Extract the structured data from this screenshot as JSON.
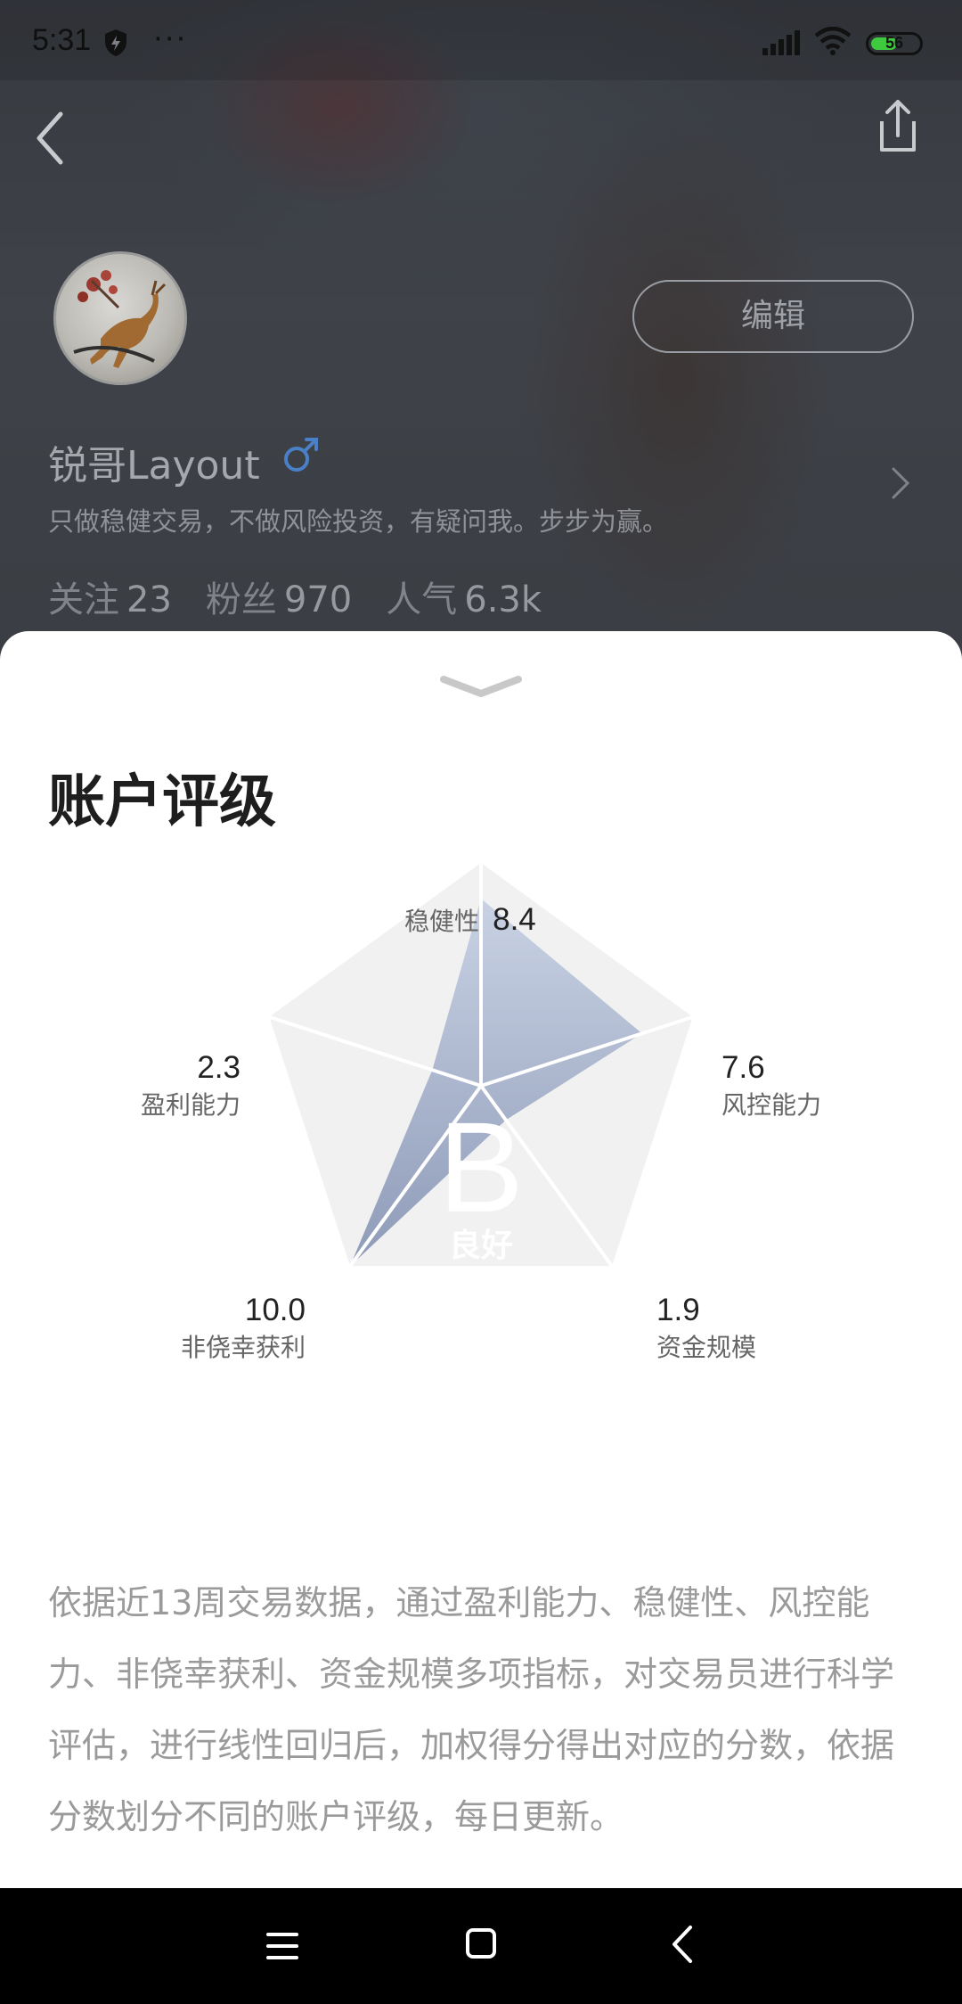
{
  "status_bar": {
    "time": "5:31",
    "dots": "···",
    "battery": "56",
    "battery_level": 0.56,
    "battery_color": "#3ec93e"
  },
  "header": {
    "back_icon": "chevron-left-icon",
    "share_icon": "share-icon"
  },
  "profile": {
    "username": "锐哥Layout",
    "gender_icon": "male-icon",
    "bio": "只做稳健交易，不做风险投资，有疑问我。步步为赢。",
    "edit_label": "编辑",
    "stats": [
      {
        "label": "关注",
        "value": "23"
      },
      {
        "label": "粉丝",
        "value": "970"
      },
      {
        "label": "人气",
        "value": "6.3k"
      }
    ]
  },
  "sheet": {
    "title": "账户评级",
    "grade_letter": "B",
    "grade_text": "良好",
    "description": "依据近13周交易数据，通过盈利能力、稳健性、风控能力、非侥幸获利、资金规模多项指标，对交易员进行科学评估，进行线性回归后，加权得分得出对应的分数，依据分数划分不同的账户评级，每日更新。"
  },
  "chart_data": {
    "type": "radar",
    "axes": [
      {
        "name": "稳健性",
        "value": 8.4
      },
      {
        "name": "风控能力",
        "value": 7.6
      },
      {
        "name": "资金规模",
        "value": 1.9
      },
      {
        "name": "非侥幸获利",
        "value": 10.0
      },
      {
        "name": "盈利能力",
        "value": 2.3
      }
    ],
    "value_labels": [
      "8.4",
      "7.6",
      "1.9",
      "10.0",
      "2.3"
    ],
    "max": 10,
    "fill_color": "#8e9bb8",
    "grid_color": "#f1f1f1"
  },
  "nav": {
    "menu_icon": "menu-icon",
    "home_icon": "home-icon",
    "back_icon": "back-icon"
  }
}
